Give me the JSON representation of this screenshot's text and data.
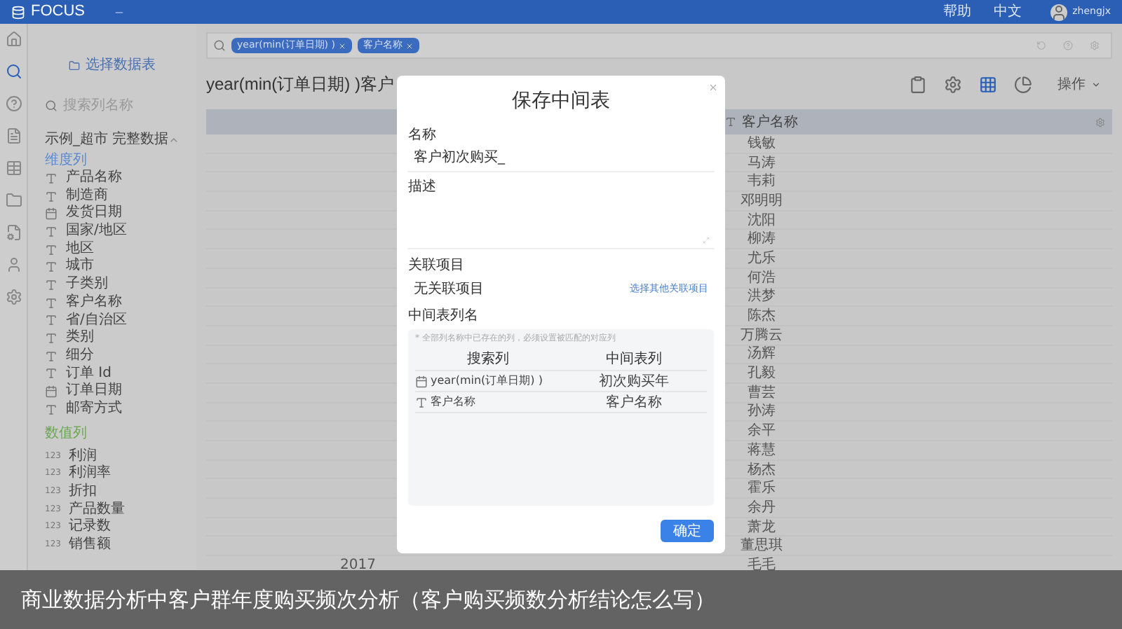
{
  "topbar": {
    "logo": "FOCUS",
    "links": [
      "帮助",
      "中文"
    ],
    "user": "zhengjx"
  },
  "rail": [
    {
      "kind": "home",
      "selected": false
    },
    {
      "kind": "search",
      "selected": true
    },
    {
      "kind": "help",
      "selected": false
    },
    {
      "kind": "doc",
      "selected": false
    },
    {
      "kind": "table",
      "selected": false
    },
    {
      "kind": "folder",
      "selected": false
    },
    {
      "kind": "file",
      "selected": false
    },
    {
      "kind": "user",
      "selected": false
    },
    {
      "kind": "settings",
      "selected": false
    }
  ],
  "sidebar": {
    "select_button": "选择数据表",
    "search": {
      "placeholder": "搜索列名称"
    },
    "dataset": "示例_超市 完整数据",
    "sections": [
      {
        "title": "维度列",
        "kind": "dimension",
        "items": [
          {
            "label": "产品名称",
            "kind": "text"
          },
          {
            "label": "制造商",
            "kind": "text"
          },
          {
            "label": "发货日期",
            "kind": "date"
          },
          {
            "label": "国家/地区",
            "kind": "text"
          },
          {
            "label": "地区",
            "kind": "text"
          },
          {
            "label": "城市",
            "kind": "text"
          },
          {
            "label": "子类别",
            "kind": "text"
          },
          {
            "label": "客户名称",
            "kind": "text"
          },
          {
            "label": "省/自治区",
            "kind": "text"
          },
          {
            "label": "类别",
            "kind": "text"
          },
          {
            "label": "细分",
            "kind": "text"
          },
          {
            "label": "订单 Id",
            "kind": "text"
          },
          {
            "label": "订单日期",
            "kind": "date"
          },
          {
            "label": "邮寄方式",
            "kind": "text"
          }
        ]
      },
      {
        "title": "数值列",
        "kind": "measure",
        "items": [
          {
            "label": "利润",
            "kind": "number",
            "type_mark": "123"
          },
          {
            "label": "利润率",
            "kind": "number",
            "type_mark": "123"
          },
          {
            "label": "折扣",
            "kind": "number",
            "type_mark": "123"
          },
          {
            "label": "产品数量",
            "kind": "number",
            "type_mark": "123"
          },
          {
            "label": "记录数",
            "kind": "number",
            "type_mark": "123"
          },
          {
            "label": "销售额",
            "kind": "number",
            "type_mark": "123"
          }
        ]
      }
    ]
  },
  "search_tokens": [
    "year(min(订单日期) )",
    "客户名称"
  ],
  "title": "year(min(订单日期) )客户",
  "toolbar": [
    {
      "kind": "clipboard",
      "selected": false
    },
    {
      "kind": "settings",
      "selected": false
    },
    {
      "kind": "table",
      "selected": true
    },
    {
      "kind": "pie",
      "selected": false
    }
  ],
  "actions_menu": "操作",
  "table": {
    "column_2": "客户名称",
    "rows": [
      {
        "name": "钱敏"
      },
      {
        "name": "马涛"
      },
      {
        "name": "韦莉"
      },
      {
        "name": "邓明明"
      },
      {
        "name": "沈阳"
      },
      {
        "name": "柳涛"
      },
      {
        "name": "尤乐"
      },
      {
        "name": "何浩"
      },
      {
        "name": "洪梦"
      },
      {
        "name": "陈杰"
      },
      {
        "name": "万腾云"
      },
      {
        "name": "汤辉"
      },
      {
        "name": "孔毅"
      },
      {
        "name": "曹芸"
      },
      {
        "name": "孙涛"
      },
      {
        "name": "余平"
      },
      {
        "name": "蒋慧"
      },
      {
        "name": "杨杰"
      },
      {
        "name": "霍乐"
      },
      {
        "name": "余丹"
      },
      {
        "name": "萧龙"
      },
      {
        "name": "董思琪"
      },
      {
        "year": "2017",
        "name": "毛毛"
      }
    ]
  },
  "dialog": {
    "title": "保存中间表",
    "name_label": "名称",
    "name_value": "客户初次购买_",
    "desc_label": "描述",
    "project_label": "关联项目",
    "project_value": "无关联项目",
    "project_link": "选择其他关联项目",
    "columns_label": "中间表列名",
    "hint": "* 全部列名称中已存在的列，必须设置被匹配的对应列",
    "mapping_headers": [
      "搜索列",
      "中间表列"
    ],
    "mapping": [
      {
        "kind": "date",
        "source": "year(min(订单日期) )",
        "target": "初次购买年"
      },
      {
        "kind": "text",
        "source": "客户名称",
        "target": "客户名称"
      }
    ],
    "confirm": "确定"
  },
  "caption": "商业数据分析中客户群年度购买频次分析（客户购买频数分析结论怎么写）"
}
